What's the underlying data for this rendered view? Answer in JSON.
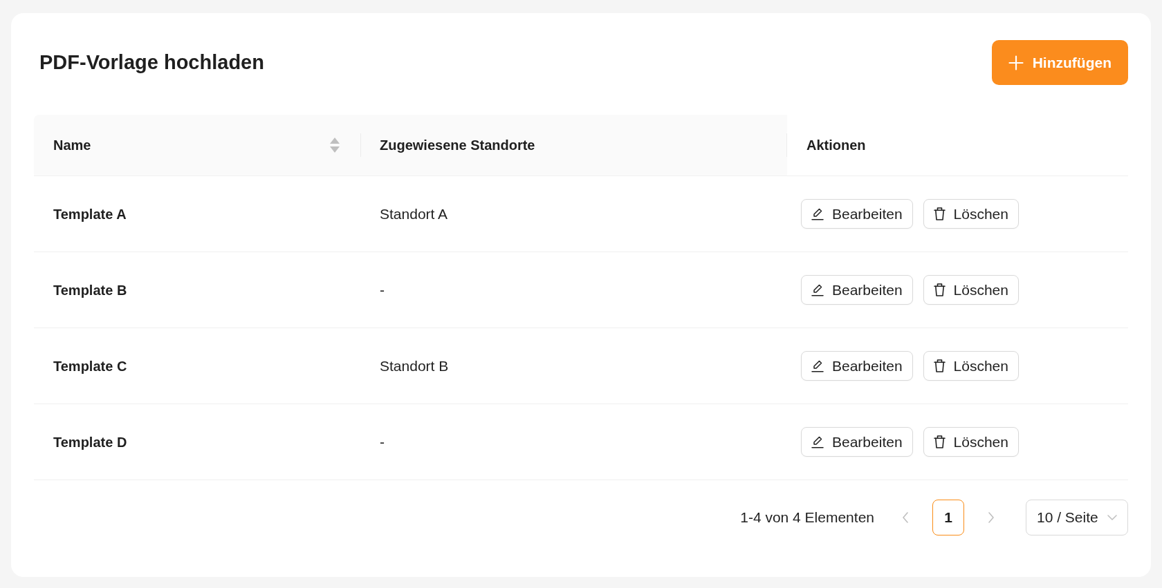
{
  "page": {
    "title": "PDF-Vorlage hochladen",
    "add_button": {
      "label": "Hinzufügen"
    }
  },
  "table": {
    "columns": [
      {
        "label": "Name",
        "sortable": true
      },
      {
        "label": "Zugewiesene Standorte",
        "sortable": false
      },
      {
        "label": "Aktionen",
        "sortable": false
      }
    ],
    "rows": [
      {
        "name": "Template A",
        "locations": "Standort A",
        "actions": [
          {
            "kind": "edit",
            "label": "Bearbeiten"
          },
          {
            "kind": "delete",
            "label": "Löschen"
          }
        ]
      },
      {
        "name": "Template B",
        "locations": "-",
        "actions": [
          {
            "kind": "edit",
            "label": "Bearbeiten"
          },
          {
            "kind": "delete",
            "label": "Löschen"
          }
        ]
      },
      {
        "name": "Template C",
        "locations": "Standort B",
        "actions": [
          {
            "kind": "edit",
            "label": "Bearbeiten"
          },
          {
            "kind": "delete",
            "label": "Löschen"
          }
        ]
      },
      {
        "name": "Template D",
        "locations": "-",
        "actions": [
          {
            "kind": "edit",
            "label": "Bearbeiten"
          },
          {
            "kind": "delete",
            "label": "Löschen"
          }
        ]
      }
    ]
  },
  "pagination": {
    "summary": "1-4 von 4 Elementen",
    "previous": {
      "disabled": true
    },
    "pages": [
      {
        "label": "1",
        "selected": true
      }
    ],
    "next": {
      "disabled": true
    },
    "page_size": "10 / Seite"
  }
}
